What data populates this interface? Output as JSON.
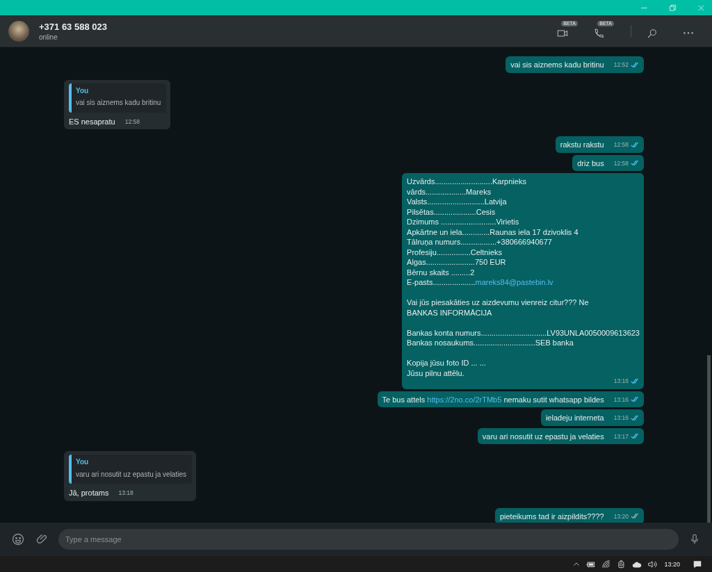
{
  "header": {
    "contact": "+371 63 588 023",
    "status": "online",
    "actions": [
      {
        "kind": "video",
        "badge": "BETA"
      },
      {
        "kind": "call",
        "badge": "BETA"
      },
      {
        "kind": "search"
      },
      {
        "kind": "more"
      }
    ]
  },
  "messages": [
    {
      "kind": "outgoing",
      "time": "12:52",
      "read": true,
      "paragraphs": [
        [
          [
            {
              "kind": "plain",
              "text": "vai sis aiznems kadu britinu"
            }
          ]
        ]
      ]
    },
    {
      "kind": "incoming",
      "quote": {
        "author": "You",
        "text": "vai sis aiznems kadu britinu"
      },
      "time": "12:58",
      "paragraphs": [
        [
          [
            {
              "kind": "plain",
              "text": "ES nesapratu"
            }
          ]
        ]
      ]
    },
    {
      "kind": "outgoing",
      "time": "12:58",
      "read": true,
      "paragraphs": [
        [
          [
            {
              "kind": "plain",
              "text": "rakstu rakstu"
            }
          ]
        ]
      ]
    },
    {
      "kind": "outgoing",
      "time": "12:58",
      "read": true,
      "paragraphs": [
        [
          [
            {
              "kind": "plain",
              "text": "driz bus"
            }
          ]
        ]
      ]
    },
    {
      "kind": "outgoing",
      "time": "13:16",
      "read": true,
      "paragraphs": [
        [
          [
            {
              "kind": "plain",
              "text": "Uzvārds...........................Karpnieks"
            }
          ],
          [
            {
              "kind": "plain",
              "text": "vārds...................Mareks"
            }
          ],
          [
            {
              "kind": "plain",
              "text": "Valsts...........................Latvija"
            }
          ],
          [
            {
              "kind": "plain",
              "text": "Pilsētas....................Cesis"
            }
          ],
          [
            {
              "kind": "plain",
              "text": "Dzimums ..........................Virietis"
            }
          ],
          [
            {
              "kind": "plain",
              "text": "Apkārtne un iela.............Raunas iela 17 dzivoklis 4"
            }
          ],
          [
            {
              "kind": "plain",
              "text": "Tālruņa numurs.................+380666940677"
            }
          ],
          [
            {
              "kind": "plain",
              "text": "Profesiju................Celtnieks"
            }
          ],
          [
            {
              "kind": "plain",
              "text": "Algas.......................750 EUR"
            }
          ],
          [
            {
              "kind": "plain",
              "text": "Bērnu skaits .........2"
            }
          ],
          [
            {
              "kind": "plain",
              "text": "E-pasts...................."
            },
            {
              "kind": "link",
              "text": "mareks84@pastebin.lv"
            }
          ]
        ],
        [
          [
            {
              "kind": "plain",
              "text": "Vai jūs piesakāties uz aizdevumu vienreiz citur??? Ne"
            }
          ],
          [
            {
              "kind": "plain",
              "text": "BANKAS INFORMĀCIJA"
            }
          ]
        ],
        [
          [
            {
              "kind": "plain",
              "text": "Bankas konta numurs...............................LV93UNLA0050009613623"
            }
          ],
          [
            {
              "kind": "plain",
              "text": "Bankas nosaukums.............................SEB banka"
            }
          ]
        ],
        [
          [
            {
              "kind": "plain",
              "text": "Kopija jūsu foto ID ... ..."
            }
          ],
          [
            {
              "kind": "plain",
              "text": "Jūsu pilnu attēlu."
            }
          ]
        ]
      ]
    },
    {
      "kind": "outgoing",
      "time": "13:16",
      "read": true,
      "paragraphs": [
        [
          [
            {
              "kind": "plain",
              "text": "Te bus attels "
            },
            {
              "kind": "link",
              "text": "https://2no.co/2rTMb5"
            },
            {
              "kind": "plain",
              "text": " nemaku sutit whatsapp bildes"
            }
          ]
        ]
      ]
    },
    {
      "kind": "outgoing",
      "time": "13:16",
      "read": true,
      "paragraphs": [
        [
          [
            {
              "kind": "plain",
              "text": "ieladeju interneta"
            }
          ]
        ]
      ]
    },
    {
      "kind": "outgoing",
      "time": "13:17",
      "read": true,
      "paragraphs": [
        [
          [
            {
              "kind": "plain",
              "text": "varu ari nosutit uz epastu ja velaties"
            }
          ]
        ]
      ]
    },
    {
      "kind": "incoming",
      "quote": {
        "author": "You",
        "text": "varu ari nosutit uz epastu ja velaties"
      },
      "time": "13:18",
      "paragraphs": [
        [
          [
            {
              "kind": "plain",
              "text": "Jā, protams"
            }
          ]
        ]
      ]
    },
    {
      "kind": "outgoing",
      "time": "13:20",
      "read": false,
      "paragraphs": [
        [
          [
            {
              "kind": "plain",
              "text": "pieteikums tad ir aizpildits????"
            }
          ]
        ]
      ]
    }
  ],
  "composer": {
    "placeholder": "Type a message"
  },
  "taskbar": {
    "clock": "13:20"
  }
}
